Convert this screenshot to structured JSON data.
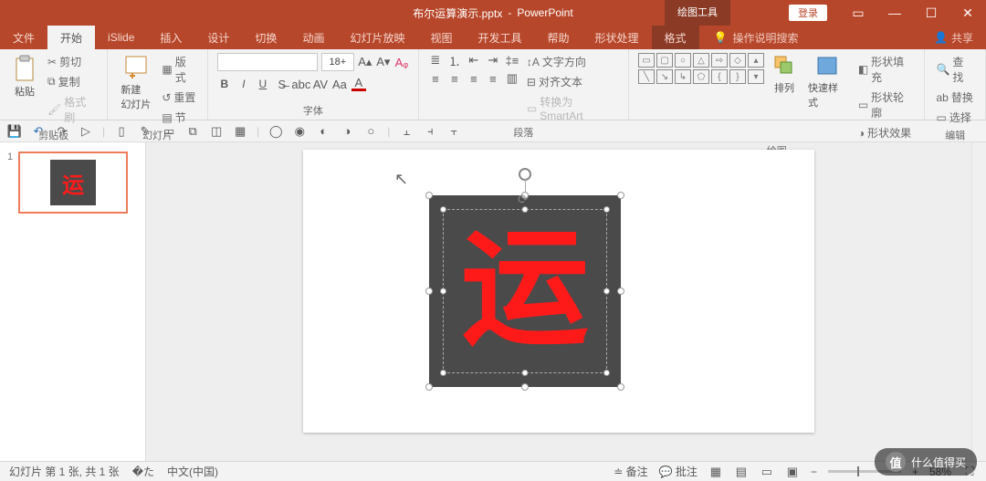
{
  "title": {
    "filename": "布尔运算演示.pptx",
    "app": "PowerPoint",
    "tool_context": "绘图工具",
    "tool_context_sub": ""
  },
  "window": {
    "login": "登录"
  },
  "menu": {
    "file": "文件",
    "home": "开始",
    "islide": "iSlide",
    "insert": "插入",
    "design": "设计",
    "transitions": "切换",
    "animations": "动画",
    "slideshow": "幻灯片放映",
    "view": "视图",
    "developer": "开发工具",
    "help": "帮助",
    "shapeproc": "形状处理",
    "format": "格式",
    "tellme": "操作说明搜索",
    "share": "共享"
  },
  "ribbon": {
    "clipboard": {
      "label": "剪贴板",
      "paste": "粘贴",
      "cut": "剪切",
      "copy": "复制",
      "format_painter": "格式刷"
    },
    "slides": {
      "label": "幻灯片",
      "new_slide": "新建\n幻灯片",
      "layout": "版式",
      "reset": "重置",
      "section": "节"
    },
    "font": {
      "label": "字体",
      "size": "18+"
    },
    "paragraph": {
      "label": "段落",
      "text_direction": "文字方向",
      "align_text": "对齐文本",
      "smartart": "转换为 SmartArt"
    },
    "drawing": {
      "label": "绘图",
      "arrange": "排列",
      "quick_styles": "快速样式",
      "shape_fill": "形状填充",
      "shape_outline": "形状轮廓",
      "shape_effects": "形状效果"
    },
    "editing": {
      "label": "编辑",
      "find": "查找",
      "replace": "替换",
      "select": "选择"
    }
  },
  "thumbs": {
    "n1": "1",
    "char": "运"
  },
  "slide": {
    "char": "运"
  },
  "status": {
    "slide_info": "幻灯片 第 1 张, 共 1 张",
    "lang": "中文(中国)",
    "notes": "备注",
    "comments": "批注",
    "zoom": "58%"
  },
  "watermark": "什么值得买"
}
